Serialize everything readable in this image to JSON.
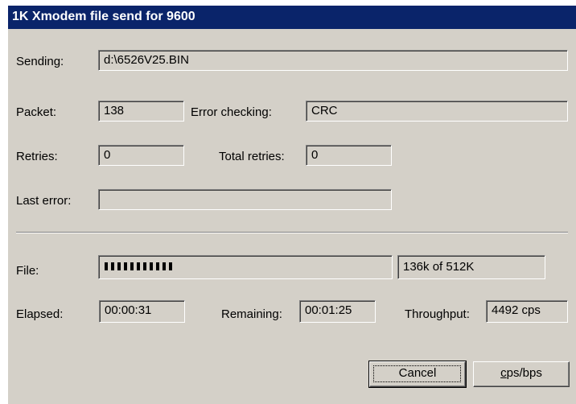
{
  "window": {
    "title": "1K Xmodem file send for 9600"
  },
  "sending": {
    "label": "Sending:",
    "value": "d:\\6526V25.BIN"
  },
  "packet": {
    "label": "Packet:",
    "value": "138"
  },
  "error_checking": {
    "label": "Error checking:",
    "value": "CRC"
  },
  "retries": {
    "label": "Retries:",
    "value": "0"
  },
  "total_retries": {
    "label": "Total retries:",
    "value": "0"
  },
  "last_error": {
    "label": "Last error:",
    "value": ""
  },
  "file": {
    "label": "File:",
    "progress_text": "136k of 512K",
    "progress_fraction": 0.266
  },
  "elapsed": {
    "label": "Elapsed:",
    "value": "00:00:31"
  },
  "remaining": {
    "label": "Remaining:",
    "value": "00:01:25"
  },
  "throughput": {
    "label": "Throughput:",
    "value": "4492 cps"
  },
  "buttons": {
    "cancel": "Cancel",
    "cps_bps_mnemonic": "c",
    "cps_bps_rest": "ps/bps"
  },
  "colors": {
    "titlebar": "#0a246a",
    "dialog_face": "#d4d0c8",
    "progress_fill": "#000000"
  }
}
